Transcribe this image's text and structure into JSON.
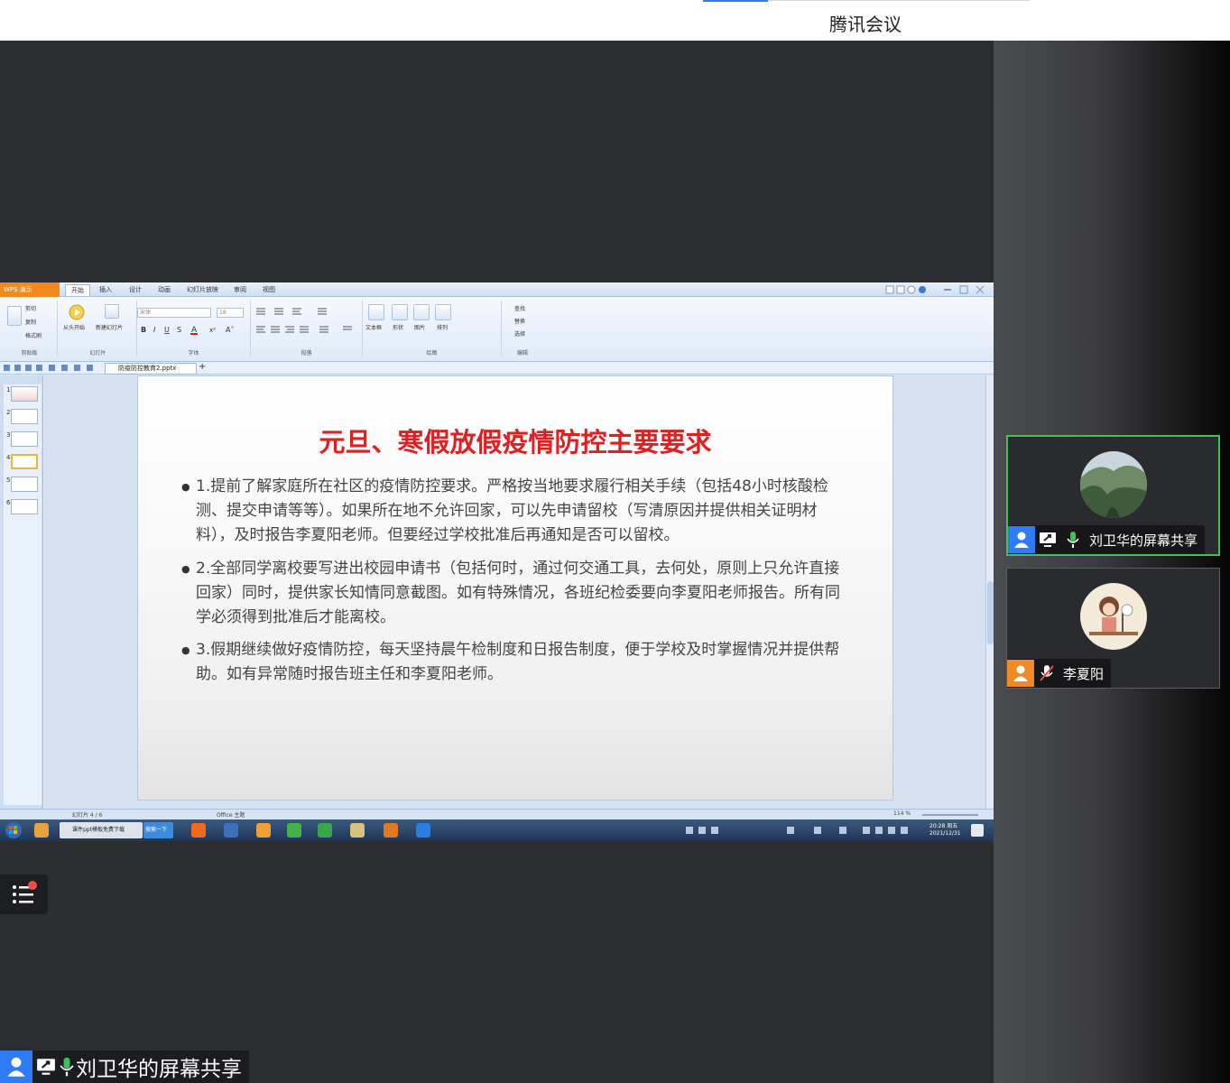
{
  "app": {
    "title": "腾讯会议"
  },
  "participants": [
    {
      "name": "刘卫华的屏幕共享",
      "sharing": true,
      "mic": "on"
    },
    {
      "name": "李夏阳",
      "sharing": false,
      "mic": "muted"
    }
  ],
  "bottom_label": "刘卫华的屏幕共享",
  "colors": {
    "accent_blue": "#2d7cf6",
    "active_green": "#3fc15a",
    "avatar_orange": "#f08a24",
    "slide_title_red": "#e02020",
    "notification_red": "#f04b4b"
  },
  "shared_screen": {
    "wps_tabs": [
      "开始",
      "插入",
      "设计",
      "动画",
      "幻灯片放映",
      "审阅",
      "视图"
    ],
    "logo": "WPS 演示",
    "ribbon": {
      "groups": [
        "剪贴板",
        "幻灯片",
        "字体",
        "段落",
        "绘图",
        "编辑"
      ],
      "font_name": "宋体",
      "font_size": "18",
      "labels": [
        "剪切",
        "复制",
        "格式刷",
        "从头开始",
        "新建幻灯片",
        "文本框",
        "形状",
        "图片",
        "排列",
        "查找",
        "替换",
        "选择"
      ]
    },
    "doc_tab": "防疫防控教育2.pptx",
    "slide": {
      "title": "元旦、寒假放假疫情防控主要要求",
      "bullets": [
        "1.提前了解家庭所在社区的疫情防控要求。严格按当地要求履行相关手续（包括48小时核酸检测、提交申请等等）。如果所在地不允许回家，可以先申请留校（写清原因并提供相关证明材料），及时报告李夏阳老师。但要经过学校批准后再通知是否可以留校。",
        "2.全部同学离校要写进出校园申请书（包括何时，通过何交通工具，去何处，原则上只允许直接回家）同时，提供家长知情同意截图。如有特殊情况，各班纪检委要向李夏阳老师报告。所有同学必须得到批准后才能离校。",
        "3.假期继续做好疫情防控，每天坚持晨午检制度和日报告制度，便于学校及时掌握情况并提供帮助。如有异常随时报告班主任和李夏阳老师。"
      ]
    },
    "thumbnails": [
      "1",
      "2",
      "3",
      "4",
      "5",
      "6"
    ],
    "status": {
      "slide_counter": "幻灯片 4 / 6",
      "theme": "Office 主题",
      "zoom": "114 %"
    },
    "taskbar": {
      "items": [
        "课件ppt模板免费下载",
        "搜索一下"
      ],
      "clock_time": "20:28 周五",
      "clock_date": "2021/12/31"
    }
  }
}
